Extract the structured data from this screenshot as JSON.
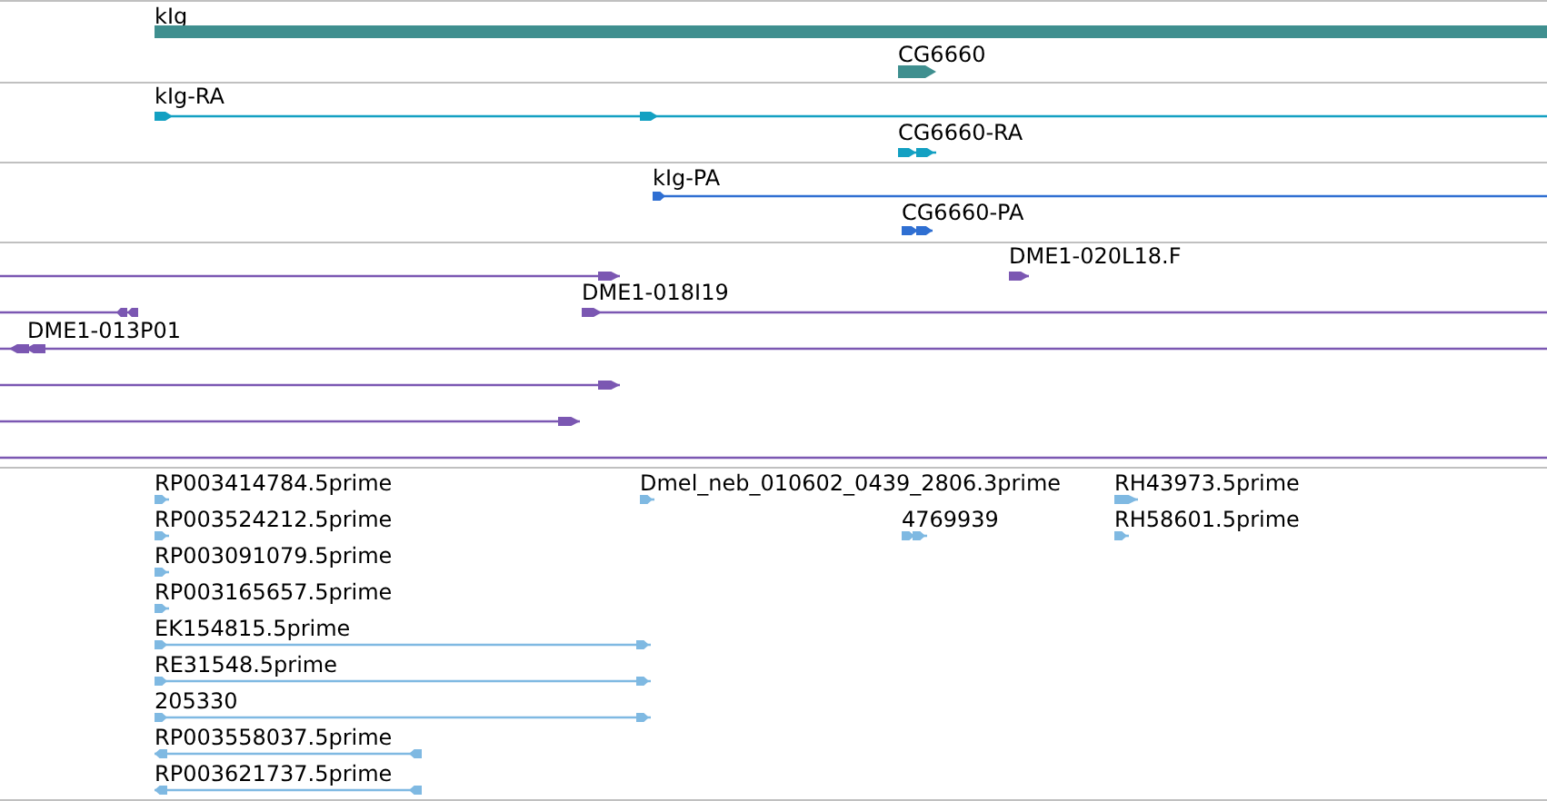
{
  "tracks": [
    {
      "color": "#3f8f8f",
      "features": [
        {
          "kind": "gene",
          "label": "kIg"
        },
        {
          "kind": "gene",
          "label": "CG6660",
          "reverse": false
        }
      ]
    },
    {
      "color": "#13a0c2",
      "features": [
        {
          "kind": "transcript",
          "label": "kIg-RA",
          "reverse": false
        },
        {
          "kind": "transcript",
          "label": "CG6660-RA",
          "reverse": false
        }
      ]
    },
    {
      "color": "#2f6fd2",
      "features": [
        {
          "kind": "transcript",
          "label": "kIg-PA",
          "reverse": false
        },
        {
          "kind": "transcript",
          "label": "CG6660-PA",
          "reverse": false
        }
      ]
    },
    {
      "color": "#7b57b2",
      "features": [
        {
          "kind": "transcript",
          "reverse": false
        },
        {
          "kind": "transcript",
          "label": "DME1-020L18.F",
          "reverse": false
        },
        {
          "kind": "transcript",
          "label": "DME1-018I19",
          "reverse": false
        },
        {
          "kind": "transcript",
          "reverse": true
        },
        {
          "kind": "transcript",
          "label": "DME1-013P01",
          "reverse": true
        },
        {
          "kind": "transcript",
          "reverse": false
        },
        {
          "kind": "transcript",
          "reverse": false
        },
        {
          "kind": "transcript"
        }
      ]
    },
    {
      "color": "#7fb9e2",
      "features": [
        {
          "kind": "transcript",
          "label": "RP003414784.5prime",
          "reverse": false
        },
        {
          "kind": "transcript",
          "label": "Dmel_neb_010602_0439_2806.3prime",
          "reverse": false
        },
        {
          "kind": "transcript",
          "label": "RH43973.5prime",
          "reverse": false
        },
        {
          "kind": "transcript",
          "label": "RP003524212.5prime",
          "reverse": false
        },
        {
          "kind": "transcript",
          "label": "4769939",
          "reverse": false
        },
        {
          "kind": "transcript",
          "label": "RH58601.5prime",
          "reverse": false
        },
        {
          "kind": "transcript",
          "label": "RP003091079.5prime",
          "reverse": false
        },
        {
          "kind": "transcript",
          "label": "RP003165657.5prime",
          "reverse": false
        },
        {
          "kind": "transcript",
          "label": "EK154815.5prime",
          "reverse": false
        },
        {
          "kind": "transcript",
          "label": "RE31548.5prime",
          "reverse": false
        },
        {
          "kind": "transcript",
          "label": "205330",
          "reverse": false
        },
        {
          "kind": "transcript",
          "label": "RP003558037.5prime",
          "reverse": true
        },
        {
          "kind": "transcript",
          "label": "RP003621737.5prime",
          "reverse": true
        }
      ]
    }
  ]
}
